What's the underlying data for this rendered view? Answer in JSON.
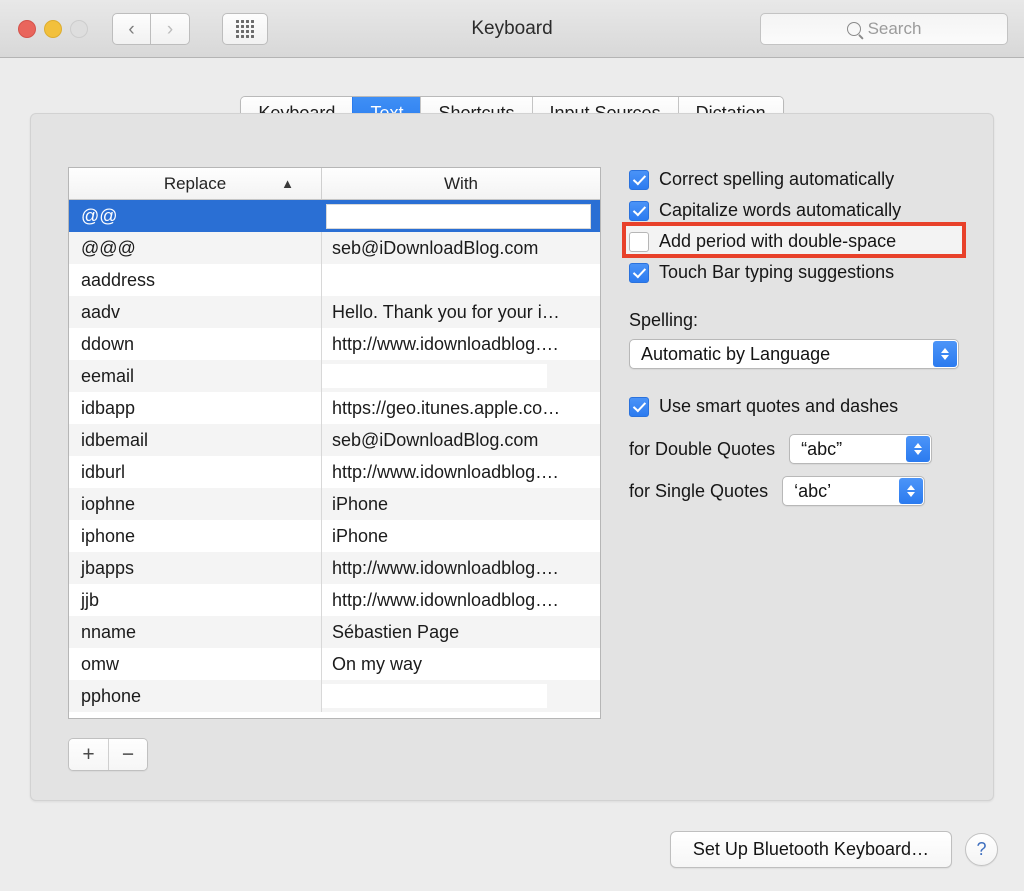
{
  "window": {
    "title": "Keyboard",
    "traffic_lights": [
      "close",
      "minimize",
      "zoom"
    ],
    "nav_back_icon": "‹",
    "nav_forward_icon": "›",
    "grid_icon": "show-all-icon"
  },
  "search": {
    "placeholder": "Search",
    "value": "",
    "icon": "search-icon"
  },
  "tabs": [
    {
      "label": "Keyboard",
      "active": false
    },
    {
      "label": "Text",
      "active": true
    },
    {
      "label": "Shortcuts",
      "active": false
    },
    {
      "label": "Input Sources",
      "active": false
    },
    {
      "label": "Dictation",
      "active": false
    }
  ],
  "table": {
    "columns": [
      {
        "label": "Replace",
        "sorted": true,
        "sort_icon": "chevron-up-icon"
      },
      {
        "label": "With",
        "sorted": false
      }
    ],
    "rows": [
      {
        "replace": "@@",
        "with": "",
        "selected": true,
        "editing": true
      },
      {
        "replace": "@@@",
        "with": "seb@iDownloadBlog.com",
        "selected": false
      },
      {
        "replace": "aaddress",
        "with": "",
        "selected": false
      },
      {
        "replace": "aadv",
        "with": "Hello. Thank you for your i…",
        "selected": false
      },
      {
        "replace": "ddown",
        "with": "http://www.idownloadblog….",
        "selected": false
      },
      {
        "replace": "eemail",
        "with": "",
        "selected": false,
        "blank_fill": true
      },
      {
        "replace": "idbapp",
        "with": "https://geo.itunes.apple.co…",
        "selected": false
      },
      {
        "replace": "idbemail",
        "with": "seb@iDownloadBlog.com",
        "selected": false
      },
      {
        "replace": "idburl",
        "with": "http://www.idownloadblog….",
        "selected": false
      },
      {
        "replace": "iophne",
        "with": "iPhone",
        "selected": false
      },
      {
        "replace": "iphone",
        "with": "iPhone",
        "selected": false
      },
      {
        "replace": "jbapps",
        "with": "http://www.idownloadblog….",
        "selected": false
      },
      {
        "replace": "jjb",
        "with": "http://www.idownloadblog….",
        "selected": false
      },
      {
        "replace": "nname",
        "with": "Sébastien Page",
        "selected": false
      },
      {
        "replace": "omw",
        "with": "On my way",
        "selected": false
      },
      {
        "replace": "pphone",
        "with": "",
        "selected": false,
        "blank_fill": true
      }
    ],
    "add_button_label": "+",
    "remove_button_label": "−"
  },
  "options": {
    "checkboxes": [
      {
        "label": "Correct spelling automatically",
        "checked": true
      },
      {
        "label": "Capitalize words automatically",
        "checked": true
      },
      {
        "label": "Add period with double-space",
        "checked": false,
        "highlighted": true
      },
      {
        "label": "Touch Bar typing suggestions",
        "checked": true
      }
    ],
    "spelling_label": "Spelling:",
    "spelling_value": "Automatic by Language",
    "smart_quotes_label": "Use smart quotes and dashes",
    "smart_quotes_checked": true,
    "double_quotes_label": "for Double Quotes",
    "double_quotes_value": "“abc”",
    "single_quotes_label": "for Single Quotes",
    "single_quotes_value": "‘abc’"
  },
  "footer": {
    "bluetooth_button": "Set Up Bluetooth Keyboard…",
    "help_button": "?"
  },
  "colors": {
    "accent_blue": "#2a7cef",
    "selection_blue": "#2a6fd4",
    "annotation_red": "#e8412a",
    "window_bg": "#ececec",
    "panel_bg": "#e3e3e3"
  }
}
